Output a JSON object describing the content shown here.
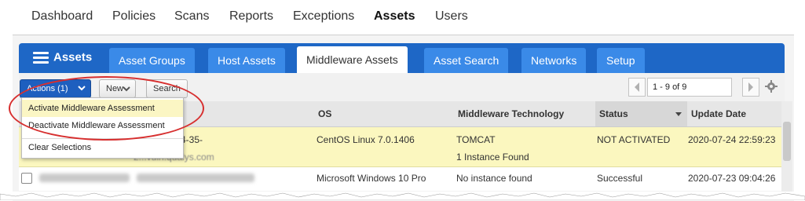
{
  "top_nav": {
    "items": [
      {
        "label": "Dashboard",
        "active": false
      },
      {
        "label": "Policies",
        "active": false
      },
      {
        "label": "Scans",
        "active": false
      },
      {
        "label": "Reports",
        "active": false
      },
      {
        "label": "Exceptions",
        "active": false
      },
      {
        "label": "Assets",
        "active": true
      },
      {
        "label": "Users",
        "active": false
      }
    ]
  },
  "module": {
    "title": "Assets",
    "icon": "list-icon",
    "tabs": [
      {
        "label": "Asset Groups",
        "active": false
      },
      {
        "label": "Host Assets",
        "active": false
      },
      {
        "label": "Middleware Assets",
        "active": true
      },
      {
        "label": "Asset Search",
        "active": false
      },
      {
        "label": "Networks",
        "active": false
      },
      {
        "label": "Setup",
        "active": false
      }
    ]
  },
  "toolbar": {
    "actions_label": "Actions (1)",
    "new_label": "New",
    "search_label": "Search",
    "pager_range": "1 - 9 of 9"
  },
  "actions_menu": {
    "items": [
      {
        "label": "Activate Middleware Assessment",
        "highlighted": true
      },
      {
        "label": "Deactivate Middleware Assessment",
        "highlighted": false
      },
      {
        "label": "Clear Selections",
        "highlighted": false
      }
    ]
  },
  "table": {
    "columns": [
      "OS",
      "Middleware Technology",
      "Status",
      "Update Date"
    ],
    "sorted_column": "Status",
    "rows": [
      {
        "name_fragment_1": "4-35-",
        "name_fragment_2": "2...vuln.qualys.com",
        "os": "CentOS Linux 7.0.1406",
        "tech": "TOMCAT",
        "tech_sub": "1 Instance Found",
        "status": "NOT ACTIVATED",
        "update_date": "2020-07-24 22:59:23",
        "selected": true
      },
      {
        "os": "Microsoft Windows 10 Pro",
        "tech": "No instance found",
        "status": "Successful",
        "update_date": "2020-07-23 09:04:26",
        "selected": false
      }
    ]
  },
  "colors": {
    "tab_bar": "#1e67c6",
    "tab": "#3a8ae8",
    "actions_button": "#1e5fbf",
    "selected_row": "#fbf7bf",
    "callout": "#d72f2f"
  }
}
